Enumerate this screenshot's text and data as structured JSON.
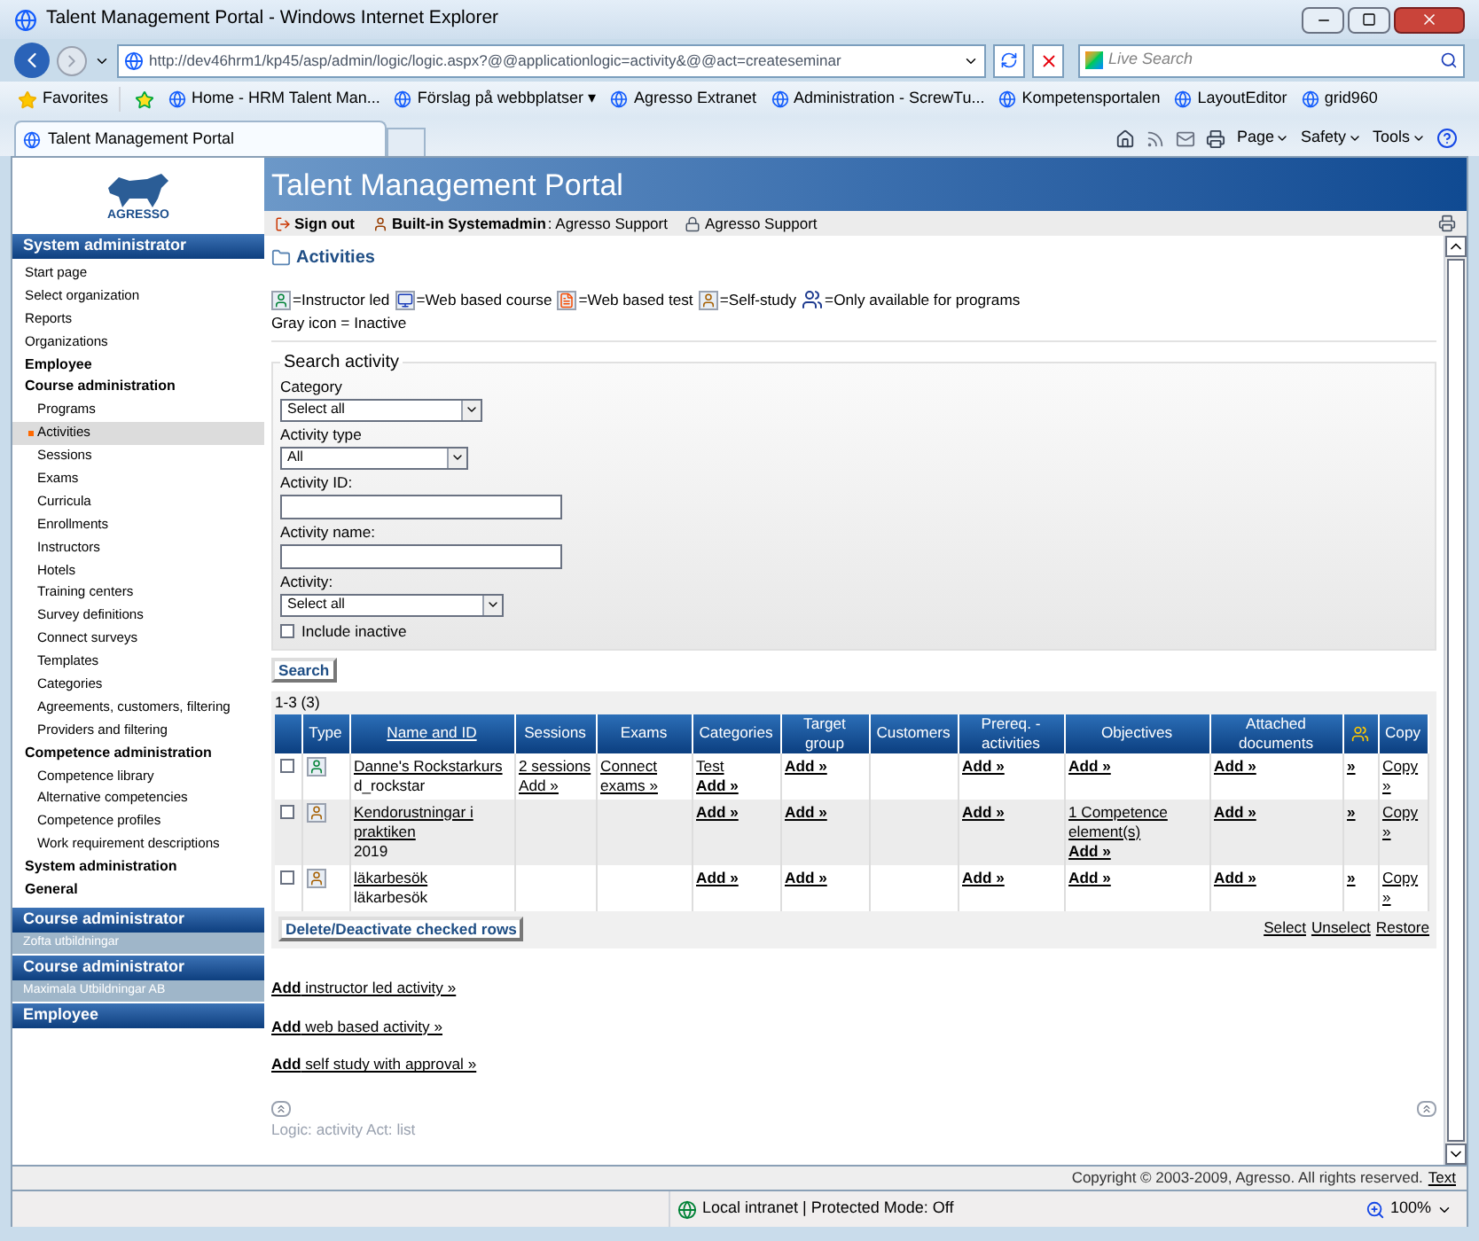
{
  "window": {
    "title": "Talent Management Portal - Windows Internet Explorer"
  },
  "address": {
    "url": "http://dev46hrm1/kp45/asp/admin/logic/logic.aspx?@@applicationlogic=activity&@@act=createseminar"
  },
  "search": {
    "placeholder": "Live Search"
  },
  "favorites": {
    "label": "Favorites",
    "links": [
      "Home - HRM Talent Man...",
      "Förslag på webbplatser ▾",
      "Agresso Extranet",
      "Administration - ScrewTu...",
      "Kompetensportalen",
      "LayoutEditor",
      "grid960"
    ]
  },
  "tabs": [
    {
      "label": "Talent Management Portal",
      "selected": true
    }
  ],
  "commands": [
    "Page",
    "Safety",
    "Tools"
  ],
  "portal": {
    "logo": "AGRESSO",
    "title": "Talent Management Portal",
    "sign_out": "Sign out",
    "user": "Built-in Systemadmin",
    "user_org": ": Agresso Support",
    "org": "Agresso Support"
  },
  "sidebar": {
    "sections": [
      {
        "title": "System administrator",
        "items": [
          {
            "label": "Start page",
            "kind": "link",
            "selected": false
          },
          {
            "label": "Select organization",
            "kind": "link",
            "selected": false
          },
          {
            "label": "Reports",
            "kind": "link",
            "selected": false
          },
          {
            "label": "Organizations",
            "kind": "link",
            "selected": false
          },
          {
            "label": "Employee",
            "kind": "group",
            "selected": false
          },
          {
            "label": "Course administration",
            "kind": "group",
            "selected": false,
            "children": [
              {
                "label": "Programs",
                "kind": "link",
                "selected": false
              },
              {
                "label": "Activities",
                "kind": "link",
                "selected": true
              },
              {
                "label": "Sessions",
                "kind": "link",
                "selected": false
              },
              {
                "label": "Exams",
                "kind": "link",
                "selected": false
              },
              {
                "label": "Curricula",
                "kind": "link",
                "selected": false
              },
              {
                "label": "Enrollments",
                "kind": "link",
                "selected": false
              },
              {
                "label": "Instructors",
                "kind": "link",
                "selected": false
              },
              {
                "label": "Hotels",
                "kind": "link",
                "selected": false
              },
              {
                "label": "Training centers",
                "kind": "link",
                "selected": false
              },
              {
                "label": "Survey definitions",
                "kind": "link",
                "selected": false
              },
              {
                "label": "Connect surveys",
                "kind": "link",
                "selected": false
              },
              {
                "label": "Templates",
                "kind": "link",
                "selected": false
              },
              {
                "label": "Categories",
                "kind": "link",
                "selected": false
              },
              {
                "label": "Agreements, customers, filtering",
                "kind": "link",
                "selected": false
              },
              {
                "label": "Providers and filtering",
                "kind": "link",
                "selected": false
              }
            ]
          },
          {
            "label": "Competence administration",
            "kind": "group",
            "selected": false,
            "children": [
              {
                "label": "Competence library",
                "kind": "link",
                "selected": false
              },
              {
                "label": "Alternative competencies",
                "kind": "link",
                "selected": false
              },
              {
                "label": "Competence profiles",
                "kind": "link",
                "selected": false
              },
              {
                "label": "Work requirement descriptions",
                "kind": "link",
                "selected": false
              }
            ]
          },
          {
            "label": "System administration",
            "kind": "group",
            "selected": false
          },
          {
            "label": "General",
            "kind": "group",
            "selected": false
          }
        ]
      },
      {
        "title": "Course administrator",
        "subtitle": "Zofta utbildningar"
      },
      {
        "title": "Course administrator",
        "subtitle": "Maximala Utbildningar AB"
      },
      {
        "title": "Employee"
      }
    ]
  },
  "page": {
    "title": "Activities",
    "legend": [
      {
        "kind": "instructor",
        "label": "=Instructor led"
      },
      {
        "kind": "web_course",
        "label": "=Web based course"
      },
      {
        "kind": "web_test",
        "label": "=Web based test"
      },
      {
        "kind": "self_study",
        "label": "=Self-study"
      },
      {
        "kind": "programs",
        "label": "=Only available for programs"
      }
    ],
    "legend_note": "Gray icon = Inactive",
    "search_form": {
      "legend": "Search activity",
      "fields": [
        {
          "kind": "select",
          "label": "Category",
          "value": "Select all"
        },
        {
          "kind": "select",
          "label": "Activity type",
          "value": "All"
        },
        {
          "kind": "text",
          "label": "Activity ID:"
        },
        {
          "kind": "text",
          "label": "Activity name:"
        },
        {
          "kind": "select",
          "label": "Activity:",
          "value": "Select all"
        }
      ],
      "include_inactive": {
        "label": "Include inactive",
        "checked": false
      },
      "button": "Search"
    },
    "results": {
      "count": "1-3 (3)",
      "columns": [
        {
          "kind": "check"
        },
        {
          "kind": "text",
          "label": "Type"
        },
        {
          "kind": "link",
          "label": "Name and ID"
        },
        {
          "kind": "text",
          "label": "Sessions"
        },
        {
          "kind": "text",
          "label": "Exams"
        },
        {
          "kind": "text",
          "label": "Categories"
        },
        {
          "kind": "text",
          "label": "Target group"
        },
        {
          "kind": "text",
          "label": "Customers"
        },
        {
          "kind": "text",
          "label": "Prereq. - activities"
        },
        {
          "kind": "text",
          "label": "Objectives"
        },
        {
          "kind": "text",
          "label": "Attached documents"
        },
        {
          "kind": "icon"
        },
        {
          "kind": "text",
          "label": "Copy"
        }
      ],
      "rows": [
        {
          "cells": [
            {
              "kind": "checkbox",
              "checked": false
            },
            {
              "kind": "instructor"
            },
            {
              "kind": "links",
              "parts": [
                {
                  "kind": "link",
                  "text": "Danne's Rockstarkurs"
                },
                {
                  "kind": "text",
                  "text": "d_rockstar"
                }
              ]
            },
            {
              "kind": "links",
              "parts": [
                {
                  "kind": "link",
                  "text": "2 sessions"
                },
                {
                  "kind": "link",
                  "text": "Add »"
                }
              ]
            },
            {
              "kind": "links",
              "parts": [
                {
                  "kind": "link",
                  "text": "Connect exams »"
                }
              ]
            },
            {
              "kind": "links",
              "parts": [
                {
                  "kind": "link",
                  "text": "Test"
                },
                {
                  "kind": "action",
                  "text": "Add »"
                }
              ]
            },
            {
              "kind": "links",
              "parts": [
                {
                  "kind": "action",
                  "text": "Add »"
                }
              ]
            },
            "",
            {
              "kind": "links",
              "parts": [
                {
                  "kind": "action",
                  "text": "Add »"
                }
              ]
            },
            {
              "kind": "links",
              "parts": [
                {
                  "kind": "action",
                  "text": "Add »"
                }
              ]
            },
            {
              "kind": "links",
              "parts": [
                {
                  "kind": "action",
                  "text": "Add »"
                }
              ]
            },
            {
              "kind": "links",
              "parts": [
                {
                  "kind": "action",
                  "text": "»"
                }
              ]
            },
            {
              "kind": "links",
              "parts": [
                {
                  "kind": "link",
                  "text": "Copy »"
                }
              ]
            }
          ]
        },
        {
          "cells": [
            {
              "kind": "checkbox",
              "checked": false
            },
            {
              "kind": "self_study"
            },
            {
              "kind": "links",
              "parts": [
                {
                  "kind": "link",
                  "text": "Kendorustningar i praktiken"
                },
                {
                  "kind": "text",
                  "text": "2019"
                }
              ]
            },
            "",
            "",
            {
              "kind": "links",
              "parts": [
                {
                  "kind": "action",
                  "text": "Add »"
                }
              ]
            },
            {
              "kind": "links",
              "parts": [
                {
                  "kind": "action",
                  "text": "Add »"
                }
              ]
            },
            "",
            {
              "kind": "links",
              "parts": [
                {
                  "kind": "action",
                  "text": "Add »"
                }
              ]
            },
            {
              "kind": "links",
              "parts": [
                {
                  "kind": "link",
                  "text": "1 Competence element(s)"
                },
                {
                  "kind": "action",
                  "text": "Add »"
                }
              ]
            },
            {
              "kind": "links",
              "parts": [
                {
                  "kind": "action",
                  "text": "Add »"
                }
              ]
            },
            {
              "kind": "links",
              "parts": [
                {
                  "kind": "action",
                  "text": "»"
                }
              ]
            },
            {
              "kind": "links",
              "parts": [
                {
                  "kind": "link",
                  "text": "Copy »"
                }
              ]
            }
          ]
        },
        {
          "cells": [
            {
              "kind": "checkbox",
              "checked": false
            },
            {
              "kind": "self_study"
            },
            {
              "kind": "links",
              "parts": [
                {
                  "kind": "link",
                  "text": "läkarbesök"
                },
                {
                  "kind": "text",
                  "text": "läkarbesök"
                }
              ]
            },
            "",
            "",
            {
              "kind": "links",
              "parts": [
                {
                  "kind": "action",
                  "text": "Add »"
                }
              ]
            },
            {
              "kind": "links",
              "parts": [
                {
                  "kind": "action",
                  "text": "Add »"
                }
              ]
            },
            "",
            {
              "kind": "links",
              "parts": [
                {
                  "kind": "action",
                  "text": "Add »"
                }
              ]
            },
            {
              "kind": "links",
              "parts": [
                {
                  "kind": "action",
                  "text": "Add »"
                }
              ]
            },
            {
              "kind": "links",
              "parts": [
                {
                  "kind": "action",
                  "text": "Add »"
                }
              ]
            },
            {
              "kind": "links",
              "parts": [
                {
                  "kind": "action",
                  "text": "»"
                }
              ]
            },
            {
              "kind": "links",
              "parts": [
                {
                  "kind": "link",
                  "text": "Copy »"
                }
              ]
            }
          ]
        }
      ],
      "delete_button": "Delete/Deactivate checked rows",
      "row_links": [
        "Select",
        "Unselect",
        "Restore"
      ]
    },
    "add_links": [
      "**Add** instructor led activity »",
      "**Add** web based activity »",
      "**Add** self study with approval »"
    ],
    "logic_note": "Logic: activity Act: list"
  },
  "footer": {
    "copyright": "Copyright © 2003-2009, Agresso. All rights reserved.",
    "link": "Text"
  },
  "status_bar": {
    "zone": "Local intranet | Protected Mode: Off",
    "zoom": "100%"
  }
}
